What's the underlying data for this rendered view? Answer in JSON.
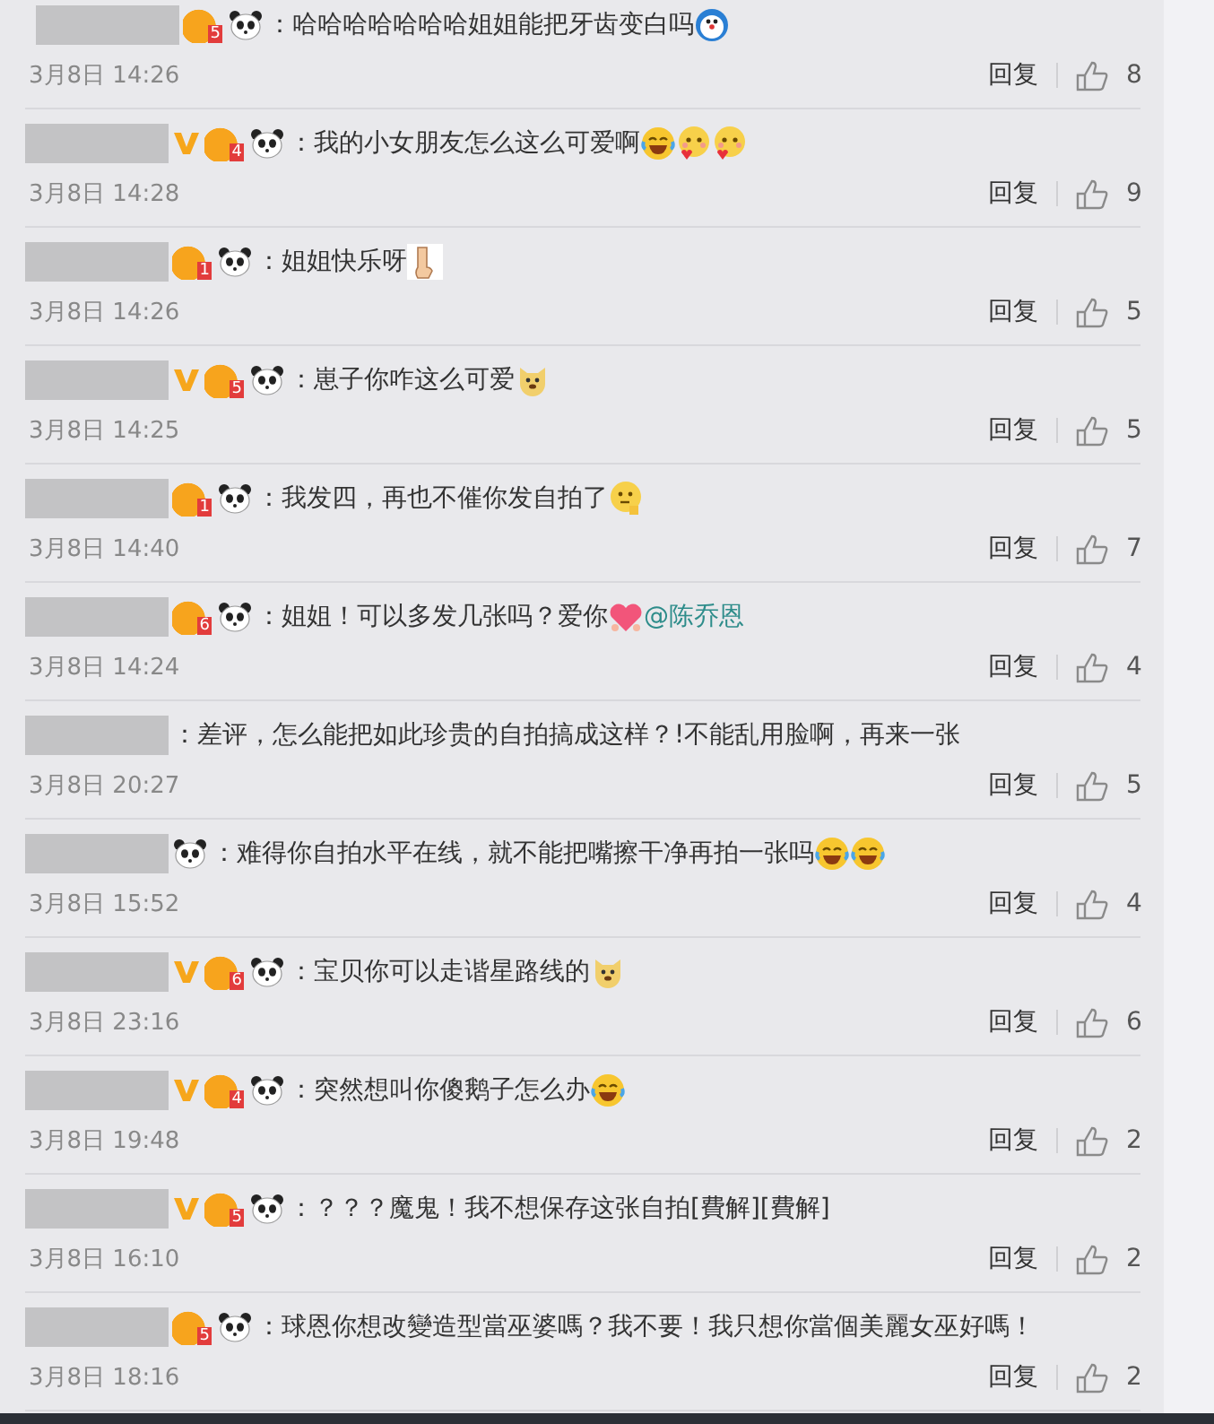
{
  "comments": [
    {
      "verified": false,
      "rank_badge": "5",
      "panda": true,
      "body": [
        {
          "kind": "text",
          "text": "：哈哈哈哈哈哈哈姐姐能把牙齿变白吗"
        },
        {
          "kind": "robot"
        }
      ],
      "time": "3月8日 14:26",
      "reply": "回复",
      "likes": "8"
    },
    {
      "verified": true,
      "rank_badge": "4",
      "panda": true,
      "body": [
        {
          "kind": "text",
          "text": "：我的小女朋友怎么这么可爱啊"
        },
        {
          "kind": "laugh"
        },
        {
          "kind": "love"
        },
        {
          "kind": "love"
        }
      ],
      "time": "3月8日 14:28",
      "reply": "回复",
      "likes": "9"
    },
    {
      "verified": false,
      "rank_badge": "1",
      "panda": true,
      "body": [
        {
          "kind": "text",
          "text": "：姐姐快乐呀"
        },
        {
          "kind": "hand"
        }
      ],
      "time": "3月8日 14:26",
      "reply": "回复",
      "likes": "5"
    },
    {
      "verified": true,
      "rank_badge": "5",
      "panda": true,
      "body": [
        {
          "kind": "text",
          "text": "：崽子你咋这么可爱"
        },
        {
          "kind": "dog"
        }
      ],
      "time": "3月8日 14:25",
      "reply": "回复",
      "likes": "5"
    },
    {
      "verified": false,
      "rank_badge": "1",
      "panda": true,
      "body": [
        {
          "kind": "text",
          "text": "：我发四，再也不催你发自拍了"
        },
        {
          "kind": "think"
        }
      ],
      "time": "3月8日 14:40",
      "reply": "回复",
      "likes": "7"
    },
    {
      "verified": false,
      "rank_badge": "6",
      "panda": true,
      "body": [
        {
          "kind": "text",
          "text": "：姐姐！可以多发几张吗？爱你"
        },
        {
          "kind": "heart"
        },
        {
          "kind": "mention",
          "text": "@陈乔恩"
        }
      ],
      "time": "3月8日 14:24",
      "reply": "回复",
      "likes": "4"
    },
    {
      "verified": false,
      "panda": false,
      "body": [
        {
          "kind": "text",
          "text": "：差评，怎么能把如此珍贵的自拍搞成这样？!不能乱用脸啊，再来一张"
        }
      ],
      "time": "3月8日 20:27",
      "reply": "回复",
      "likes": "5"
    },
    {
      "verified": false,
      "panda": true,
      "body": [
        {
          "kind": "text",
          "text": "：难得你自拍水平在线，就不能把嘴擦干净再拍一张吗"
        },
        {
          "kind": "laugh"
        },
        {
          "kind": "laugh"
        }
      ],
      "time": "3月8日 15:52",
      "reply": "回复",
      "likes": "4"
    },
    {
      "verified": true,
      "rank_badge": "6",
      "panda": true,
      "body": [
        {
          "kind": "text",
          "text": "：宝贝你可以走谐星路线的"
        },
        {
          "kind": "dog"
        }
      ],
      "time": "3月8日 23:16",
      "reply": "回复",
      "likes": "6"
    },
    {
      "verified": true,
      "rank_badge": "4",
      "panda": true,
      "body": [
        {
          "kind": "text",
          "text": "：突然想叫你傻鹅子怎么办"
        },
        {
          "kind": "laugh"
        }
      ],
      "time": "3月8日 19:48",
      "reply": "回复",
      "likes": "2"
    },
    {
      "verified": true,
      "rank_badge": "5",
      "panda": true,
      "body": [
        {
          "kind": "text",
          "text": "：？？？魔鬼！我不想保存这张自拍[費解][費解]"
        }
      ],
      "time": "3月8日 16:10",
      "reply": "回复",
      "likes": "2"
    },
    {
      "verified": false,
      "rank_badge": "5",
      "panda": true,
      "body": [
        {
          "kind": "text",
          "text": "：球恩你想改變造型當巫婆嗎？我不要！我只想你當個美麗女巫好嗎！"
        }
      ],
      "time": "3月8日 18:16",
      "reply": "回复",
      "likes": "2"
    }
  ]
}
